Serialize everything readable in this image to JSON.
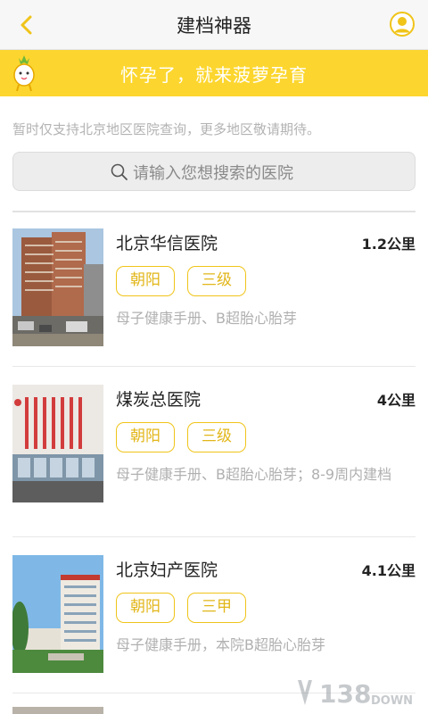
{
  "header": {
    "title": "建档神器",
    "back_icon": "chevron-left-icon",
    "user_icon": "user-avatar-icon",
    "accent_color": "#f0c419"
  },
  "banner": {
    "text": "怀孕了，就来菠萝孕育",
    "background": "#fcd62e"
  },
  "notice": "暂时仅支持北京地区医院查询，更多地区敬请期待。",
  "search": {
    "placeholder": "请输入您想搜索的医院"
  },
  "hospitals": [
    {
      "name": "北京华信医院",
      "distance": "1.2公里",
      "area": "朝阳",
      "level": "三级",
      "services": "母子健康手册、B超胎心胎芽"
    },
    {
      "name": "煤炭总医院",
      "distance": "4公里",
      "area": "朝阳",
      "level": "三级",
      "services": "母子健康手册、B超胎心胎芽；8-9周内建档"
    },
    {
      "name": "北京妇产医院",
      "distance": "4.1公里",
      "area": "朝阳",
      "level": "三甲",
      "services": "母子健康手册，本院B超胎心胎芽"
    }
  ],
  "watermark": {
    "number": "138",
    "word": "DOWN"
  }
}
